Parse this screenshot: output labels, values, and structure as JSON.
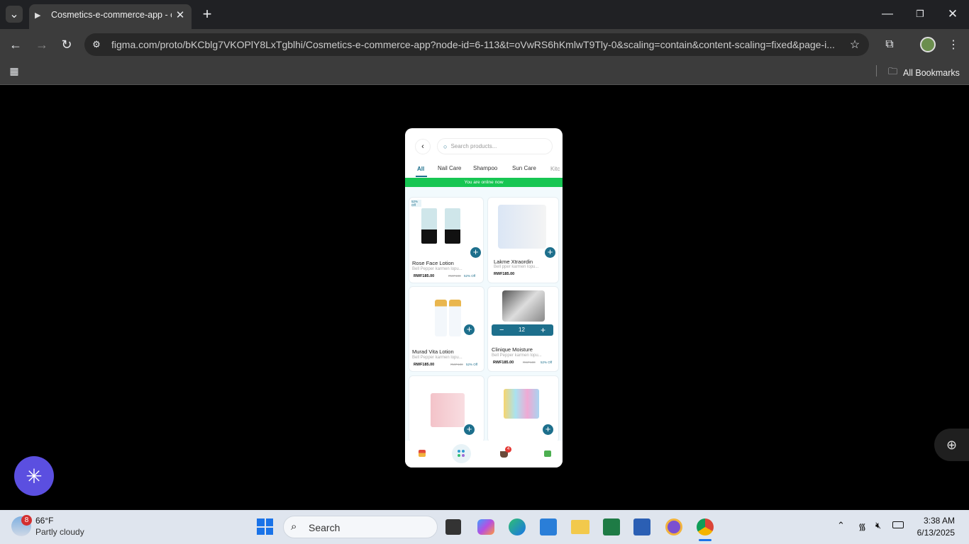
{
  "browser": {
    "tab_title": "Cosmetics-e-commerce-app - c",
    "url": "figma.com/proto/bKCblg7VKOPlY8LxTgblhi/Cosmetics-e-commerce-app?node-id=6-113&t=oVwRS6hKmlwT9Tly-0&scaling=contain&content-scaling=fixed&page-i...",
    "all_bookmarks": "All Bookmarks"
  },
  "app": {
    "search_placeholder": "Search products...",
    "categories": [
      "All",
      "Nail Care",
      "Shampoo",
      "Sun Care",
      "Kitc"
    ],
    "online_banner": "You are online now",
    "products": [
      {
        "name": "Rose Face Lotion",
        "desc": "Bell Pepper karmen lopu...",
        "price": "RWF185.00",
        "old_price": "RWF100",
        "off": "52% Off",
        "badge": "52% Off"
      },
      {
        "name": "Lakme Xtraordin",
        "desc": "Bell pper karmen lopu...",
        "price": "RWF185.00"
      },
      {
        "name": "Murad Vita Lotion",
        "desc": "Bell Pepper karmen lopu...",
        "price": "RWF185.00",
        "old_price": "RWF100",
        "off": "52% Off"
      },
      {
        "name": "Clinique Moisture",
        "desc": "Bell Pepper karmen lopu...",
        "price": "RWF185.00",
        "old_price": "RWF100",
        "off": "52% Off",
        "quantity": "12"
      },
      {
        "name": "",
        "desc": "",
        "price": ""
      },
      {
        "name": "",
        "desc": "",
        "price": ""
      }
    ],
    "cart_badge": "4",
    "brand_color": "#1d6f8c",
    "banner_color": "#17c653"
  },
  "taskbar": {
    "weather_badge": "8",
    "temperature": "66°F",
    "weather_desc": "Partly cloudy",
    "search_label": "Search",
    "time": "3:38 AM",
    "date": "6/13/2025"
  }
}
